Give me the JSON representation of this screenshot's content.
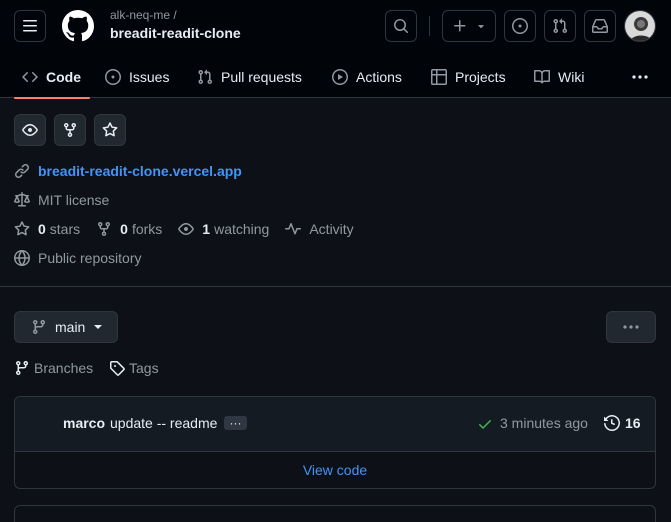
{
  "header": {
    "owner": "alk-neq-me /",
    "repo": "breadit-readit-clone"
  },
  "tabs": [
    {
      "label": "Code",
      "icon": "code-icon",
      "active": true
    },
    {
      "label": "Issues",
      "icon": "issue-opened-icon"
    },
    {
      "label": "Pull requests",
      "icon": "git-pull-request-icon"
    },
    {
      "label": "Actions",
      "icon": "play-icon"
    },
    {
      "label": "Projects",
      "icon": "table-icon"
    },
    {
      "label": "Wiki",
      "icon": "book-icon"
    }
  ],
  "about": {
    "website": "breadit-readit-clone.vercel.app",
    "license": "MIT license",
    "stars_count": "0",
    "stars_label": "stars",
    "forks_count": "0",
    "forks_label": "forks",
    "watching_count": "1",
    "watching_label": "watching",
    "activity_label": "Activity",
    "visibility": "Public repository"
  },
  "branch": {
    "name": "main",
    "branches_label": "Branches",
    "tags_label": "Tags"
  },
  "commit": {
    "author": "marco",
    "message": "update -- readme",
    "ellipsis": "···",
    "time": "3 minutes ago",
    "count": "16",
    "view_code": "View code"
  },
  "colors": {
    "accent_link": "#4493f8",
    "tab_underline": "#f78166",
    "success": "#3fb950"
  }
}
